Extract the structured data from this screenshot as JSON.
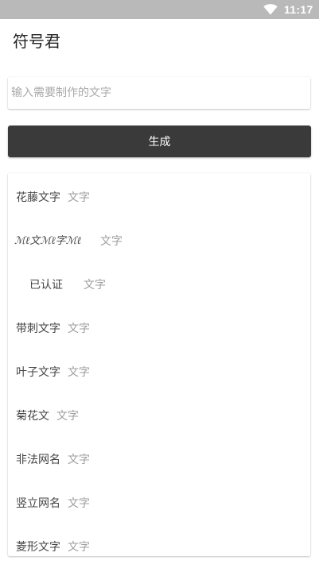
{
  "status_bar": {
    "time": "11:17",
    "icons": [
      "wifi-icon"
    ]
  },
  "app": {
    "title": "符号君"
  },
  "input": {
    "placeholder": "输入需要制作的文字",
    "value": ""
  },
  "generate_button": {
    "label": "生成"
  },
  "list": {
    "items": [
      {
        "name": "花藤文字",
        "tag": "文字"
      },
      {
        "name": "ℳℓ文ℳℓ字ℳℓ",
        "tag": "文字"
      },
      {
        "name": "已认证",
        "tag": "文字"
      },
      {
        "name": "带刺文字",
        "tag": "文字"
      },
      {
        "name": "叶子文字",
        "tag": "文字"
      },
      {
        "name": "菊花文",
        "tag": "文字"
      },
      {
        "name": "非法网名",
        "tag": "文字"
      },
      {
        "name": "竖立网名",
        "tag": "文字"
      },
      {
        "name": "菱形文字",
        "tag": "文字"
      }
    ]
  },
  "colors": {
    "status_bar": "#b9b9b9",
    "button": "#3a3a3a",
    "item_text": "#444444",
    "tag_text": "#9e9e9e"
  }
}
